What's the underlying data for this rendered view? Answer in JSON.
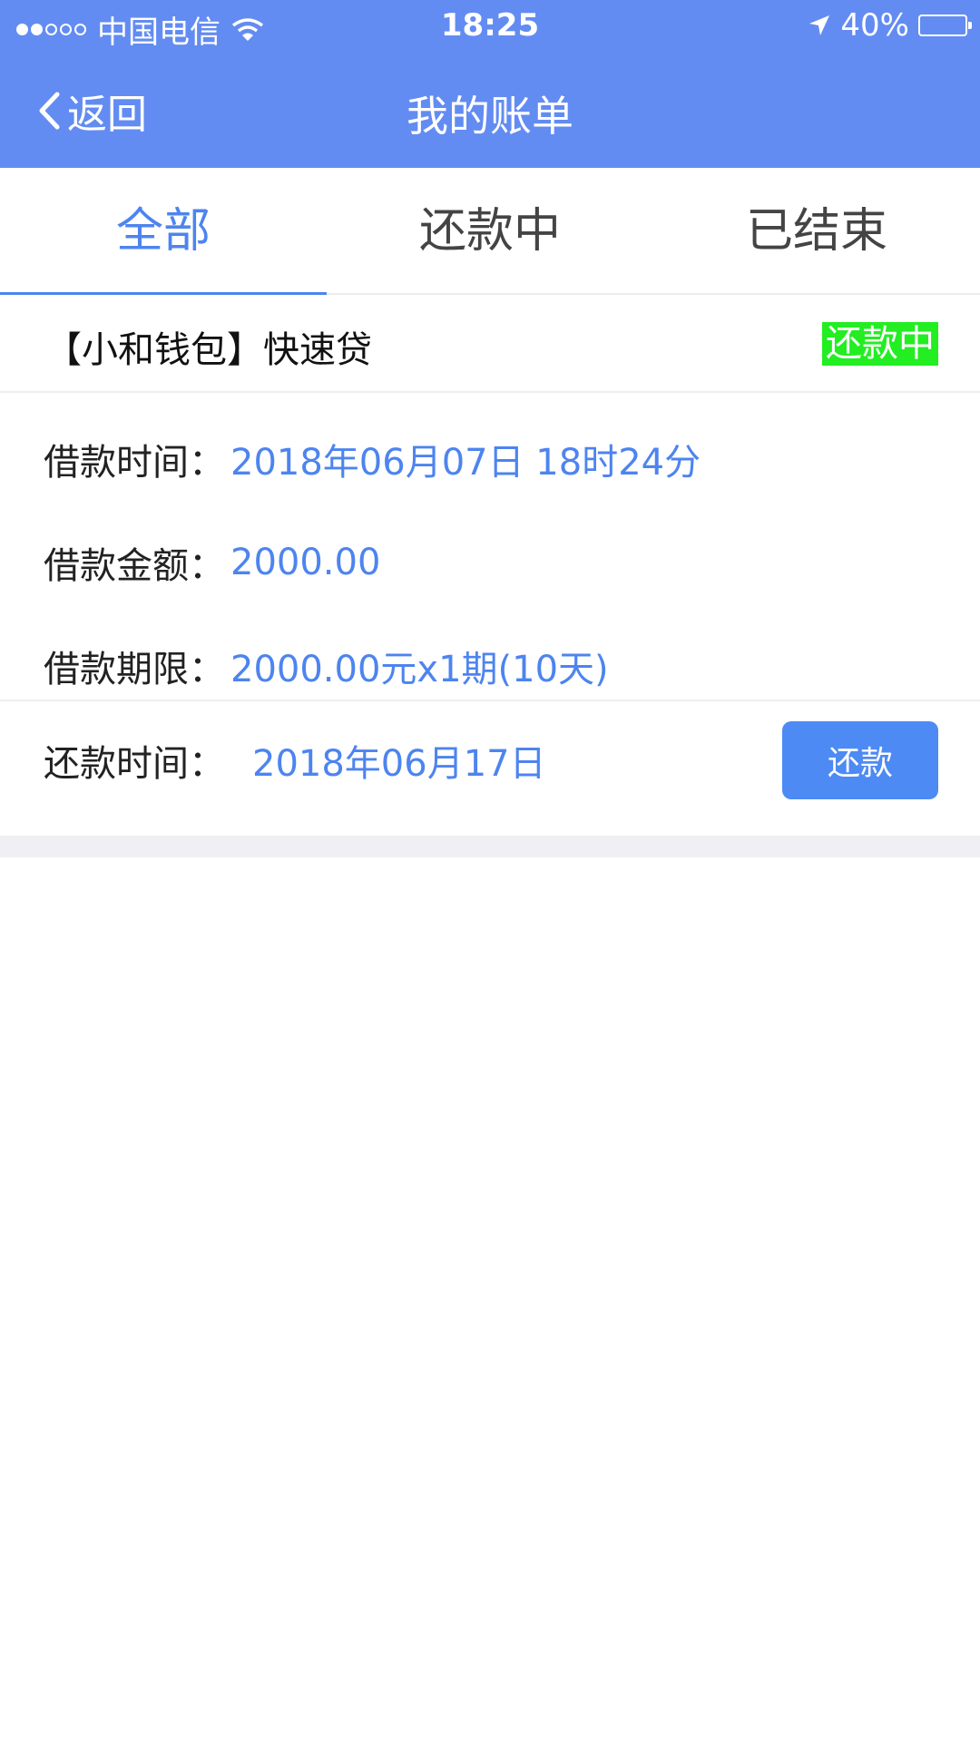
{
  "status_bar": {
    "carrier": "中国电信",
    "time": "18:25",
    "battery": "40%",
    "battery_level": 0.4,
    "icons": [
      "signal-dots-icon",
      "wifi-icon",
      "location-arrow-icon",
      "battery-icon"
    ]
  },
  "nav": {
    "back_label": "返回",
    "title": "我的账单",
    "icons": [
      "chevron-left-icon"
    ]
  },
  "tabs": [
    {
      "label": "全部",
      "active": true
    },
    {
      "label": "还款中",
      "active": false
    },
    {
      "label": "已结束",
      "active": false
    }
  ],
  "loan": {
    "name": "【小和钱包】快速贷",
    "status": "还款中",
    "rows": [
      {
        "label": "借款时间：",
        "value": "2018年06月07日 18时24分"
      },
      {
        "label": "借款金额：",
        "value": "2000.00"
      },
      {
        "label": "借款期限：",
        "value": "2000.00元x1期(10天)"
      }
    ],
    "repay": {
      "label": "还款时间：",
      "date": "2018年06月17日",
      "button": "还款"
    }
  },
  "colors": {
    "header_bg": "#638cf2",
    "accent": "#4d84ef",
    "status_badge_bg": "#22ee22",
    "button_bg": "#4d8af4"
  }
}
